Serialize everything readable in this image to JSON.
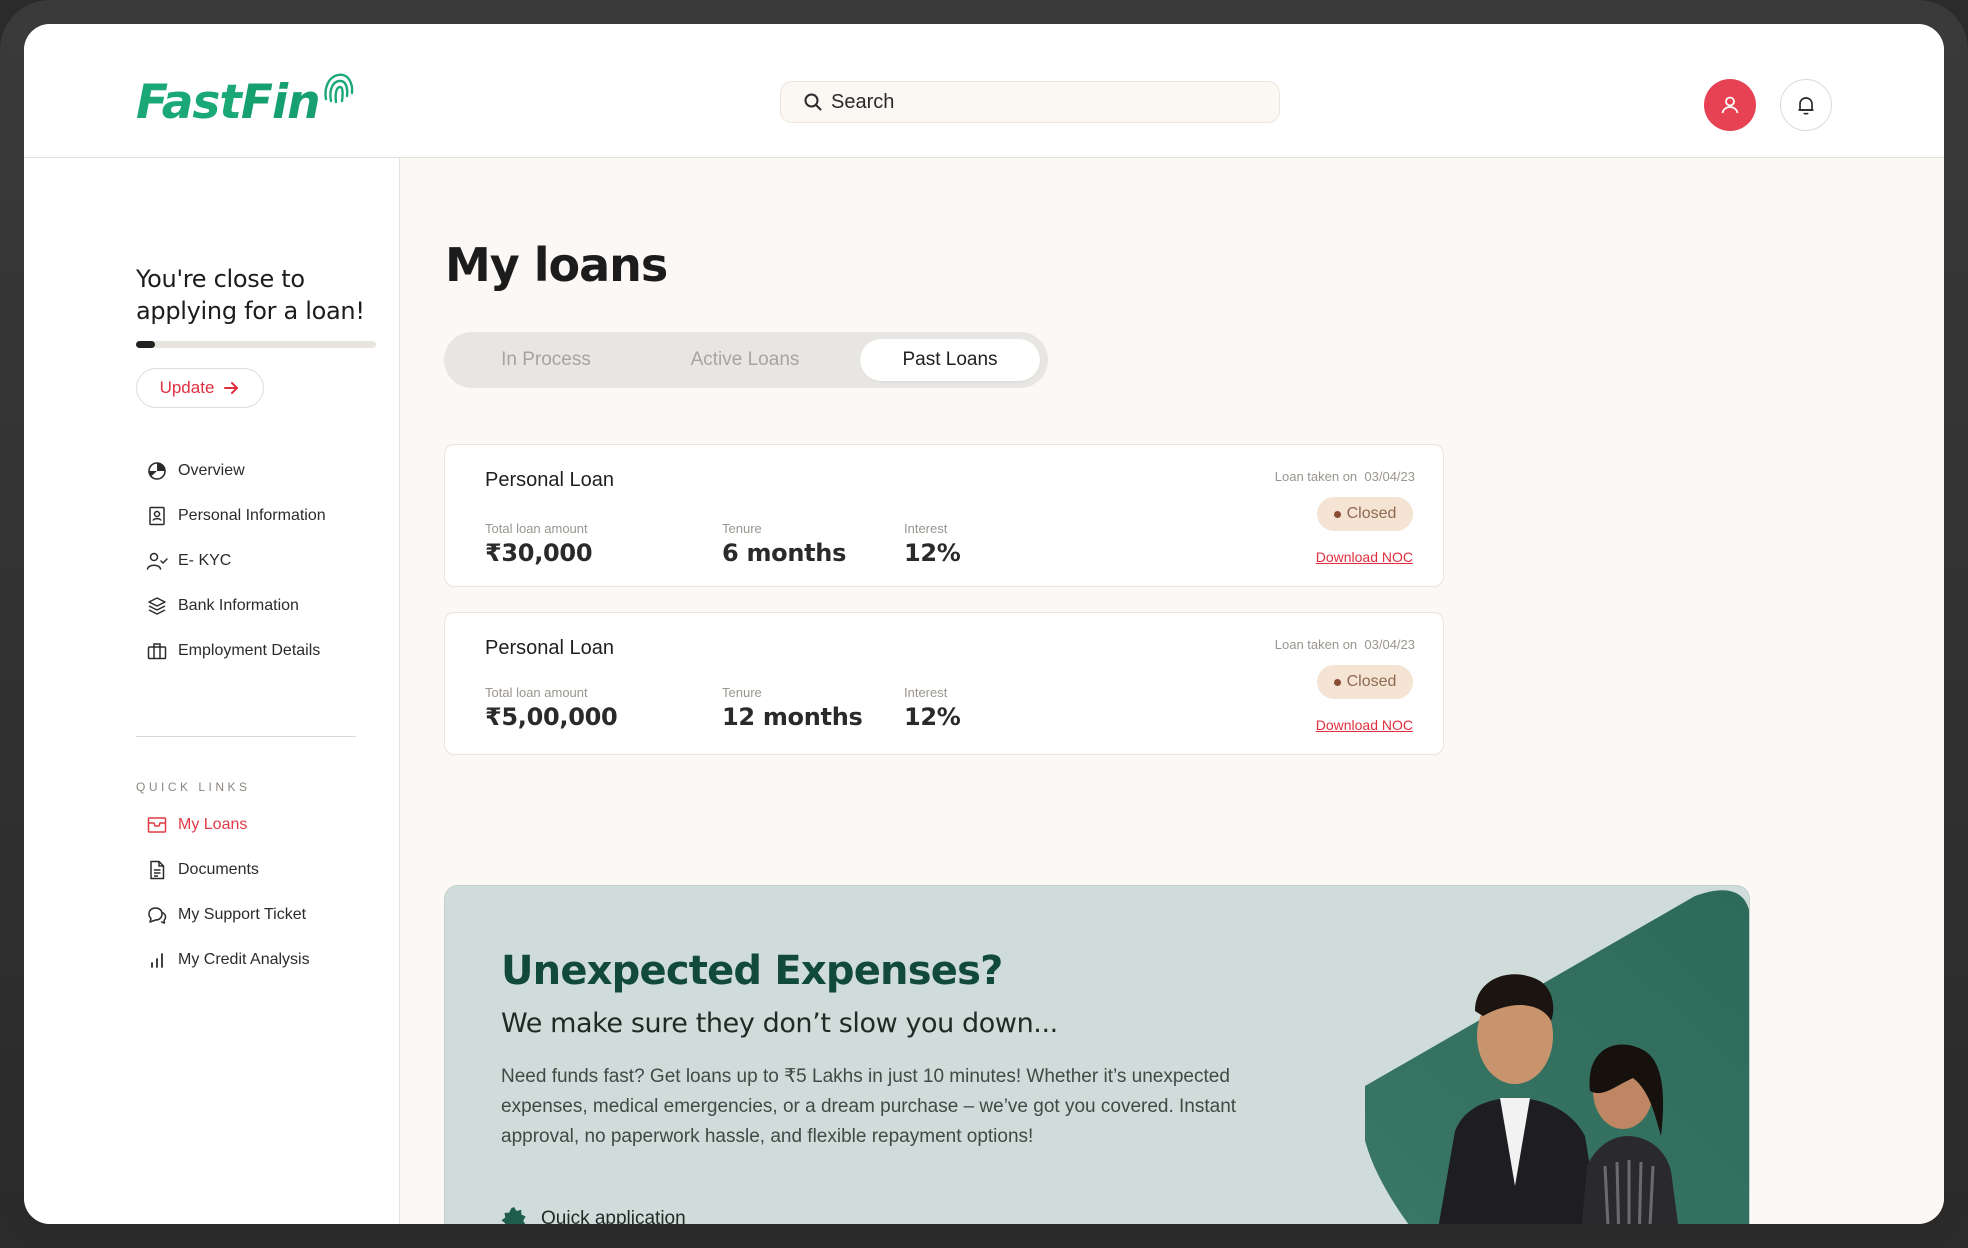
{
  "brand": {
    "name_part1": "Fast",
    "name_part2": "Fin",
    "accent": "#1aa877"
  },
  "header": {
    "search_placeholder": "Search"
  },
  "sidebar": {
    "progress_title": "You're close to applying for a loan!",
    "progress_fraction": 0.08,
    "update_label": "Update",
    "items": [
      {
        "label": "Overview",
        "icon": "pie-chart-icon"
      },
      {
        "label": "Personal Information",
        "icon": "id-card-icon"
      },
      {
        "label": "E- KYC",
        "icon": "user-check-icon"
      },
      {
        "label": "Bank Information",
        "icon": "layers-icon"
      },
      {
        "label": "Employment Details",
        "icon": "briefcase-icon"
      }
    ],
    "quick_links_heading": "QUICK LINKS",
    "quick_links": [
      {
        "label": "My Loans",
        "icon": "mailbox-icon",
        "active": true
      },
      {
        "label": "Documents",
        "icon": "document-icon"
      },
      {
        "label": "My Support Ticket",
        "icon": "chat-bubbles-icon"
      },
      {
        "label": "My Credit Analysis",
        "icon": "bar-chart-icon"
      }
    ]
  },
  "main": {
    "title": "My loans",
    "tabs": [
      {
        "label": "In Process"
      },
      {
        "label": "Active Loans"
      },
      {
        "label": "Past Loans",
        "selected": true
      }
    ],
    "loans": [
      {
        "name": "Personal Loan",
        "amount_label": "Total loan amount",
        "amount": "₹30,000",
        "tenure_label": "Tenure",
        "tenure": "6 months",
        "interest_label": "Interest",
        "interest": "12%",
        "taken_label": "Loan taken on",
        "taken_date": "03/04/23",
        "status": "Closed",
        "action": "Download NOC"
      },
      {
        "name": "Personal Loan",
        "amount_label": "Total loan amount",
        "amount": "₹5,00,000",
        "tenure_label": "Tenure",
        "tenure": "12 months",
        "interest_label": "Interest",
        "interest": "12%",
        "taken_label": "Loan taken on",
        "taken_date": "03/04/23",
        "status": "Closed",
        "action": "Download NOC"
      }
    ]
  },
  "promo": {
    "title": "Unexpected Expenses?",
    "subtitle": "We make sure they don’t slow you down...",
    "body": "Need funds fast? Get loans up to ₹5 Lakhs in just 10 minutes! Whether it’s unexpected expenses, medical emergencies, or a dream purchase – we’ve got you covered. Instant approval, no paperwork hassle, and flexible repayment options!",
    "features": [
      "Quick application"
    ]
  },
  "colors": {
    "danger": "#e64253",
    "badge_bg": "#f5e3d3",
    "promo_bg": "#cfdcd9",
    "promo_title": "#114a3a"
  }
}
